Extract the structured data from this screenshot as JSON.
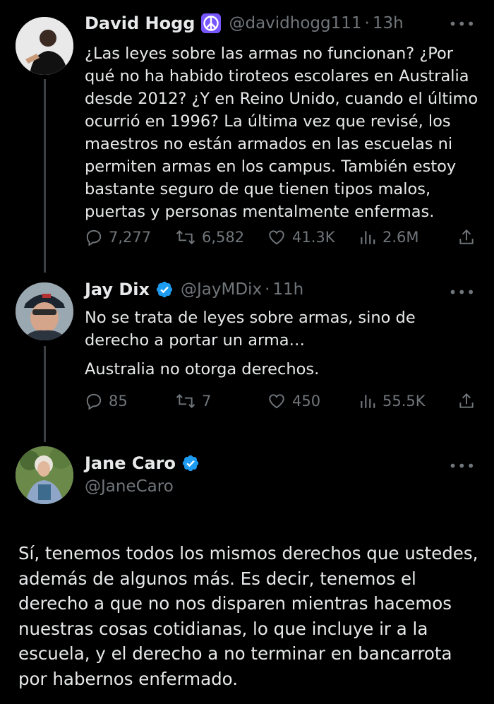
{
  "tweets": [
    {
      "name": "David Hogg",
      "handle": "@davidhogg111",
      "time": "13h",
      "badge": "peace-symbol",
      "text": "¿Las leyes sobre las armas no funcionan? ¿Por qué no ha habido tiroteos escolares en Australia desde 2012? ¿Y en Reino Unido, cuando el último ocurrió en 1996? La última vez que revisé, los maestros no están armados en las escuelas ni permiten armas en los campus. También estoy bastante seguro de que tienen tipos malos, puertas y personas mentalmente enfermas.",
      "replies": "7,277",
      "retweets": "6,582",
      "likes": "41.3K",
      "views": "2.6M"
    },
    {
      "name": "Jay Dix",
      "handle": "@JayMDix",
      "time": "11h",
      "badge": "verified",
      "text1": "No se trata de leyes sobre armas, sino de derecho a portar un arma…",
      "text2": "Australia no otorga derechos.",
      "replies": "85",
      "retweets": "7",
      "likes": "450",
      "views": "55.5K"
    },
    {
      "name": "Jane Caro",
      "handle": "@JaneCaro",
      "badge": "verified",
      "text": "Sí, tenemos todos los mismos derechos que ustedes, además de algunos más. Es decir, tenemos el derecho a que no nos disparen mientras hacemos nuestras cosas cotidianas, lo que incluye ir a la escuela, y el derecho a no terminar en bancarrota por habernos enfermado."
    }
  ],
  "separator": "·",
  "more_icon": "more-horizontal-icon",
  "colors": {
    "verified": "#1d9bf0",
    "peace_badge": "#7856ff",
    "muted": "#71767b",
    "text": "#e7e9ea"
  }
}
